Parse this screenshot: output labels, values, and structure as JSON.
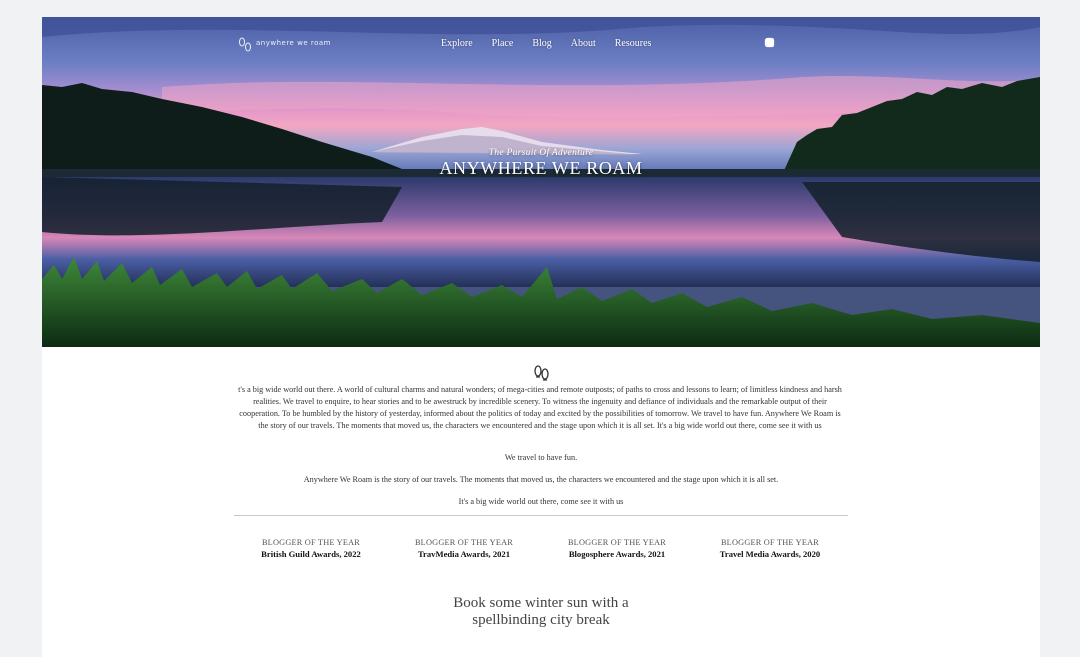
{
  "site": {
    "logo_text": "anywhere we roam"
  },
  "nav": {
    "items": [
      {
        "label": "Explore"
      },
      {
        "label": "Place"
      },
      {
        "label": "Blog"
      },
      {
        "label": "About"
      },
      {
        "label": "Resoures"
      }
    ],
    "social_icons": [
      "circle-icon",
      "instagram-icon",
      "twitter-icon",
      "search-icon"
    ]
  },
  "hero": {
    "subtitle": "The Pursuit Of Adventure",
    "title": "ANYWHERE WE ROAM"
  },
  "intro": {
    "paragraph": "t's a big wide world out there. A world of cultural charms and natural wonders; of mega-cities and remote outposts; of paths to cross and lessons to learn; of limitless kindness and harsh realities. We travel to enquire, to hear stories and to be awestruck by incredible scenery. To witness the ingenuity and defiance of individuals and the remarkable output of their cooperation. To be humbled by the history of yesterday, informed about the politics of today and excited by the possibilities of tomorrow. We travel to have fun. Anywhere We Roam is the story of our travels. The moments that moved us, the characters we encountered and the stage upon which it is all set. It's a big wide world out there, come see it with us",
    "line1": "We travel to have fun.",
    "line2": "Anywhere We Roam is the story of our travels. The moments that moved us, the characters we encountered and the stage upon which it is all set.",
    "line3": "It's a big wide world out there, come see it with us"
  },
  "awards": [
    {
      "title": "BLOGGER OF THE YEAR",
      "source": "British Guild Awards, 2022"
    },
    {
      "title": "BLOGGER OF THE YEAR",
      "source": "TravMedia Awards, 2021"
    },
    {
      "title": "BLOGGER OF THE YEAR",
      "source": "Blogosphere Awards, 2021"
    },
    {
      "title": "BLOGGER OF THE YEAR",
      "source": "Travel Media Awards, 2020"
    }
  ],
  "cta": {
    "line1": "Book some winter sun with a",
    "line2": "spellbinding city break"
  }
}
